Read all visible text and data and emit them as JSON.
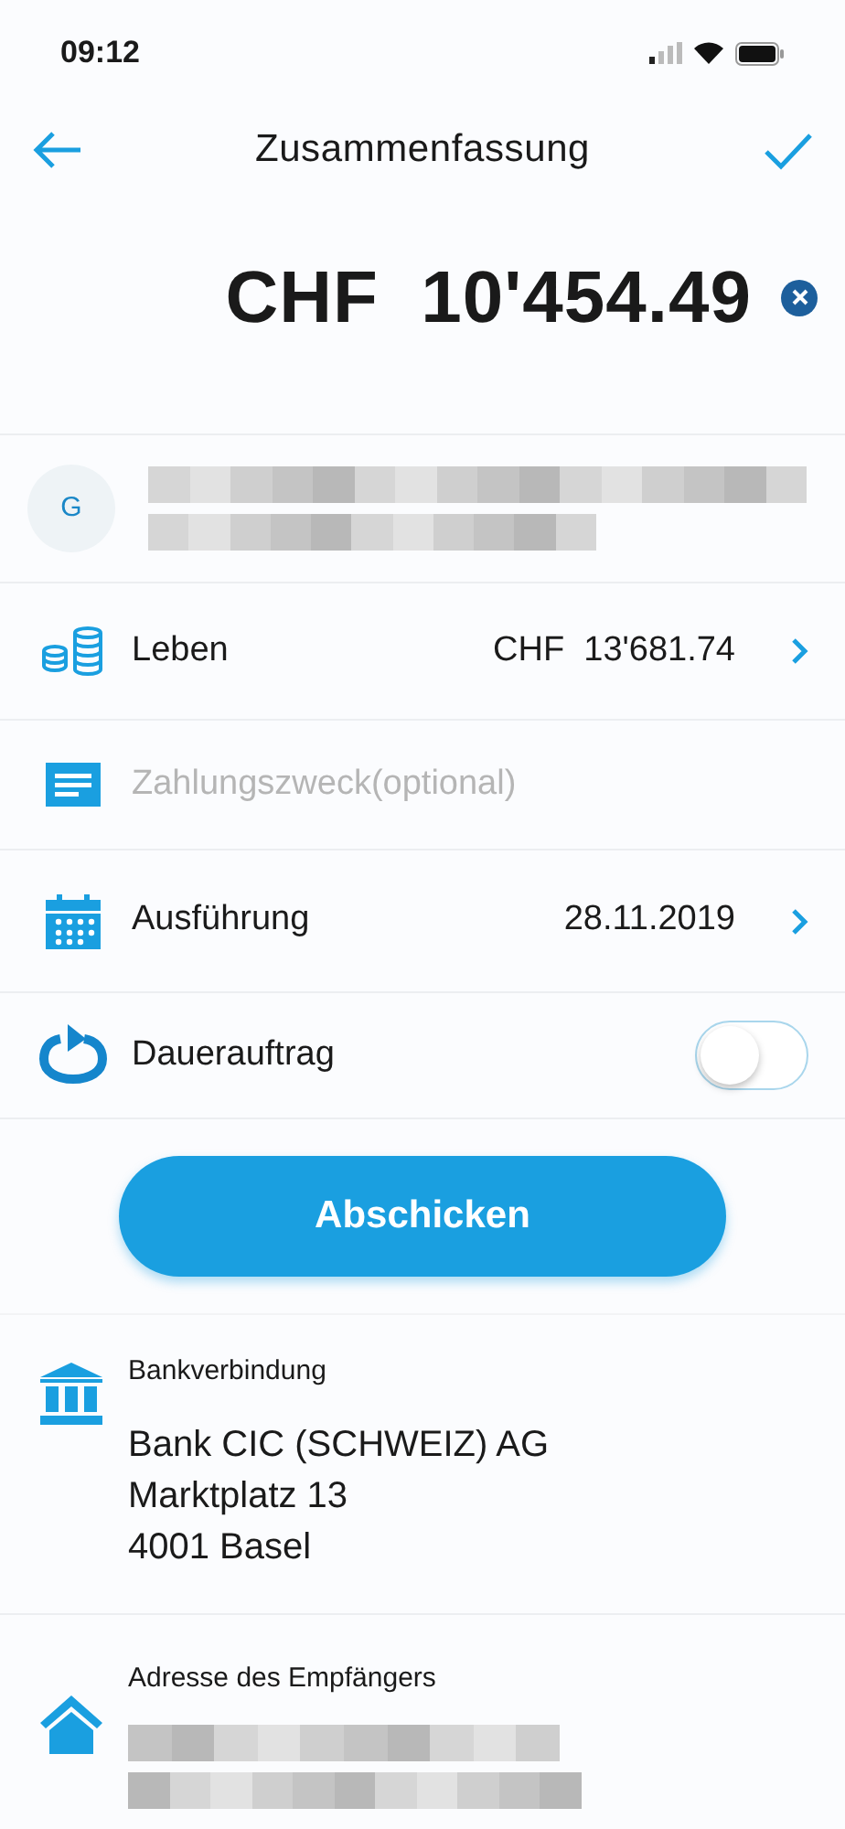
{
  "status_bar": {
    "time": "09:12"
  },
  "header": {
    "title": "Zusammenfassung"
  },
  "amount": {
    "text": "CHF  10'454.49"
  },
  "payee": {
    "initial": "G"
  },
  "rows": [
    {
      "kind": "value",
      "label": "Leben",
      "value": "CHF  13'681.74"
    },
    {
      "kind": "input",
      "placeholder": "Zahlungszweck(optional)"
    },
    {
      "kind": "value",
      "label": "Ausführung",
      "value": "28.11.2019"
    },
    {
      "kind": "toggle",
      "label": "Dauerauftrag",
      "on": false
    }
  ],
  "submit_button": "Abschicken",
  "bank": {
    "heading": "Bankverbindung",
    "lines": [
      "Bank CIC (SCHWEIZ) AG",
      "Marktplatz 13",
      "4001 Basel"
    ]
  },
  "recipient": {
    "heading": "Adresse des Empfängers"
  }
}
